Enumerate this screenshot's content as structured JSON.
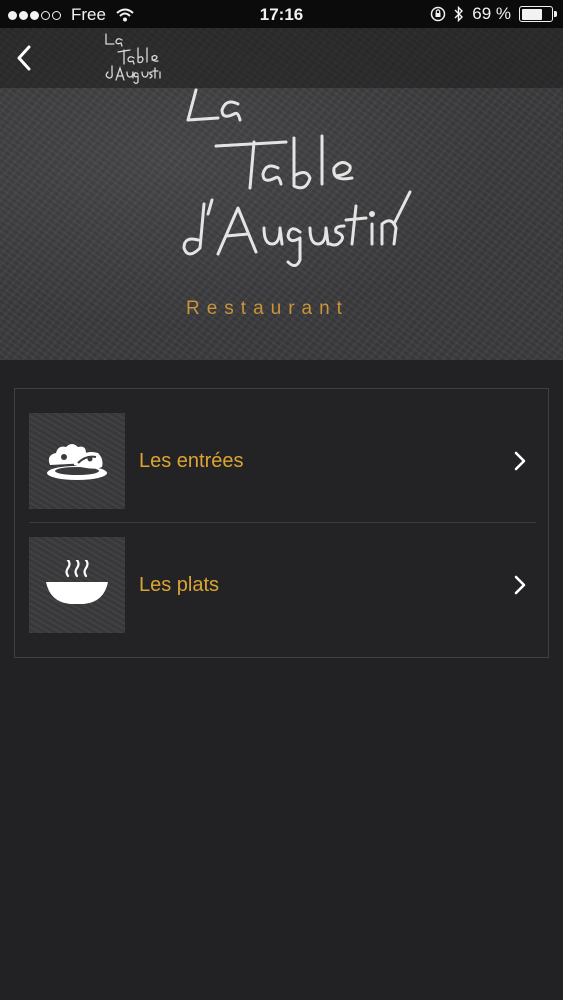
{
  "status_bar": {
    "carrier": "Free",
    "time": "17:16",
    "battery_text": "69 %",
    "battery_level": 0.69
  },
  "header": {
    "logo_text": "La Table d'Augustin",
    "subtitle": "Restaurant"
  },
  "menu": {
    "items": [
      {
        "label": "Les entrées",
        "icon": "salad-plate-icon"
      },
      {
        "label": "Les plats",
        "icon": "steaming-bowl-icon"
      }
    ]
  },
  "colors": {
    "accent": "#dca434",
    "background": "#222123"
  }
}
